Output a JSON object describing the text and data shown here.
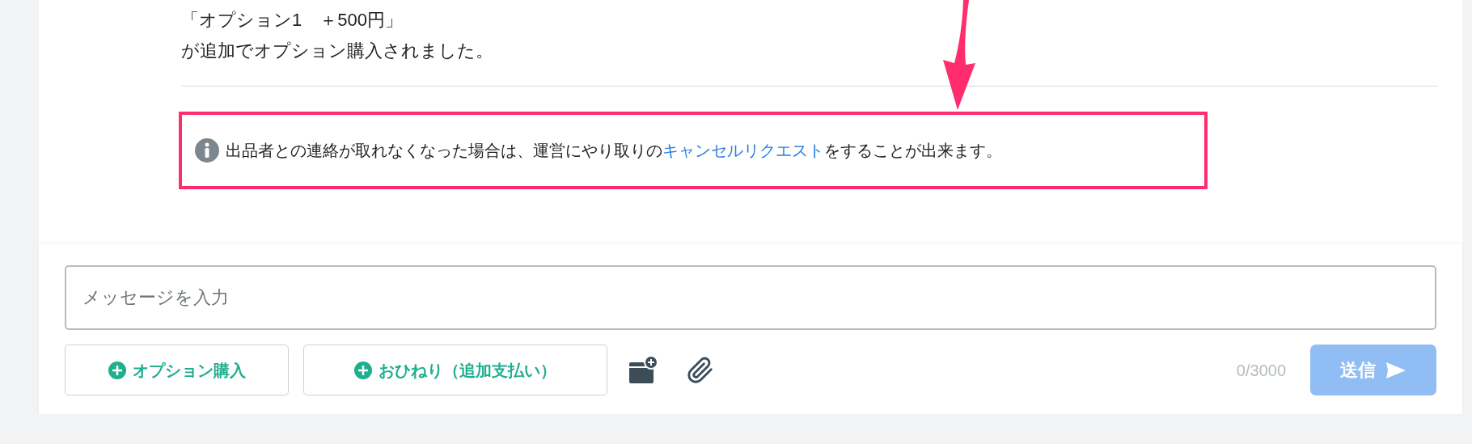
{
  "message": {
    "lines": [
      "「オプション1　＋500円」",
      "が追加でオプション購入されました。"
    ]
  },
  "notice": {
    "text_before": "出品者との連絡が取れなくなった場合は、運営にやり取りの",
    "link": "キャンセルリクエスト",
    "text_after": "をすることが出来ます。",
    "highlighted": true
  },
  "composer": {
    "placeholder": "メッセージを入力",
    "buttons": [
      "オプション購入",
      "おひねり（追加支払い）"
    ],
    "counter": "0/3000",
    "send": {
      "label": "送信",
      "disabled": true
    }
  }
}
